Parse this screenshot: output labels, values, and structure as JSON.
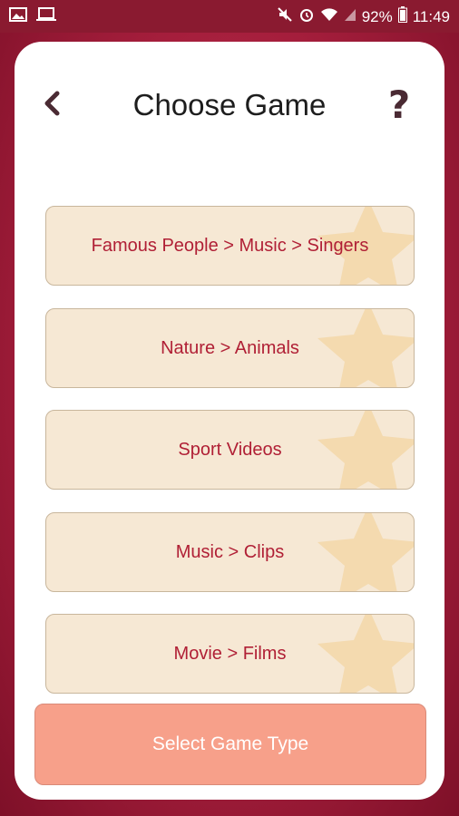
{
  "status_bar": {
    "battery": "92%",
    "time": "11:49",
    "left_icons": [
      "image-icon",
      "laptop-icon"
    ],
    "right_icons": [
      "mute-icon",
      "alarm-icon",
      "wifi-icon",
      "signal-icon",
      "battery-icon"
    ]
  },
  "header": {
    "back_icon": "chevron-left-icon",
    "title": "Choose Game",
    "help_label": "?"
  },
  "games": [
    {
      "label": "Famous People > Music > Singers"
    },
    {
      "label": "Nature > Animals"
    },
    {
      "label": "Sport Videos"
    },
    {
      "label": "Music > Clips"
    },
    {
      "label": "Movie > Films"
    }
  ],
  "footer": {
    "select_label": "Select Game Type"
  },
  "colors": {
    "background": "#a51e3c",
    "card": "#ffffff",
    "item_bg": "#f6e8d4",
    "item_text": "#b01f35",
    "star": "#f3d7a8",
    "button_bg": "#f7a08a",
    "button_text": "#ffffff"
  }
}
